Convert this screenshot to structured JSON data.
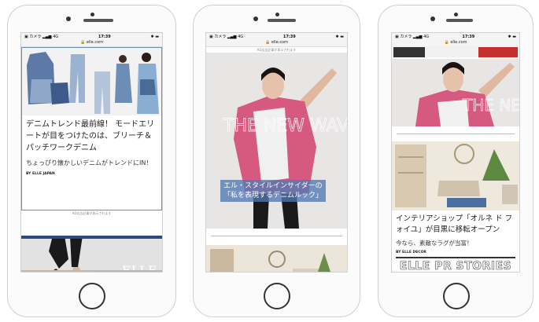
{
  "status": {
    "carrier": "カメラ",
    "network": "4G",
    "time": "17:39",
    "url": "elle.com"
  },
  "phone1": {
    "headline": "デニムトレンド最前線！ モードエリートが目をつけたのは、ブリーチ＆パッチワークデニム",
    "subtitle": "ちょっぴり懐かしいデニムがトレンドにIN！",
    "byline": "BY ELLE JAPAN",
    "ad_notice": "AD広告記事が表示されます",
    "watermark": "ELLE"
  },
  "phone2": {
    "ad_notice": "AD広告記事が表示されます",
    "hero_text": "THE NEW WAVE",
    "caption_line1": "エル・スタイルインサイダーの",
    "caption_line2": "「私を表現するデニムルック」"
  },
  "phone3": {
    "hero_text": "THE NEW",
    "headline": "インテリアショップ「オルネ ド フォイユ」が目黒に移転オープン",
    "subtitle": "今なら、素敵なラグが当富！",
    "byline": "BY ELLE DECOR",
    "banner": "ELLE PR STORIES"
  }
}
